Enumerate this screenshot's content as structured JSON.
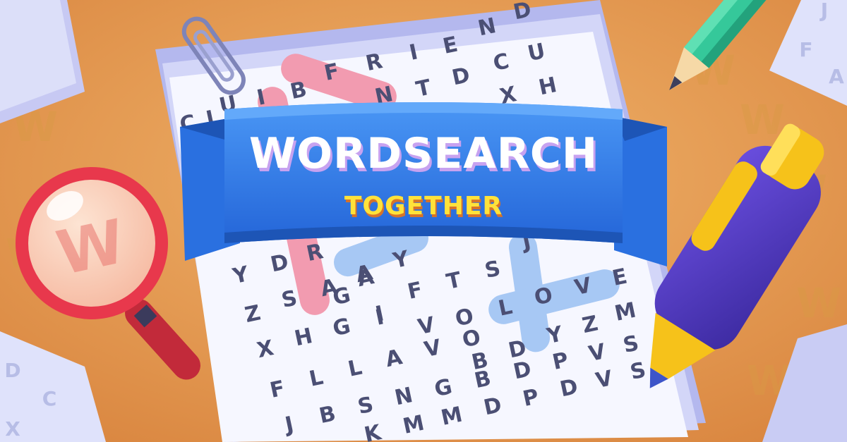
{
  "title": {
    "main": "WORDSEARCH",
    "sub": "TOGETHER"
  },
  "grid_rows": [
    {
      "letters": [
        "D"
      ]
    },
    {
      "letters": [
        "F",
        "R",
        "I",
        "E",
        "N"
      ]
    },
    {
      "letters": [
        "C",
        "U"
      ]
    },
    {
      "letters": [
        "N",
        "T",
        "D"
      ]
    },
    {
      "letters": [
        "U",
        "I",
        "B"
      ]
    },
    {
      "letters": [
        "X",
        "H"
      ]
    },
    {
      "letters": [
        "C",
        "I"
      ]
    },
    {
      "letters": [
        "Y",
        "D",
        "R",
        "A",
        "Y",
        "I",
        "T",
        "J"
      ]
    },
    {
      "letters": [
        "S",
        "A",
        "A",
        "Y",
        "I",
        "F",
        "T",
        "S",
        "J"
      ]
    },
    {
      "letters": [
        "Z",
        "S",
        "X",
        "G",
        "I",
        "F",
        "T",
        "S",
        "L",
        "O",
        "V",
        "E"
      ]
    },
    {
      "letters": [
        "X",
        "H",
        "G",
        "I",
        "V",
        "O",
        "L",
        "O",
        "V",
        "Y",
        "Z",
        "M"
      ]
    },
    {
      "letters": [
        "X",
        "H",
        "G",
        "L",
        "A",
        "V",
        "O",
        "B",
        "D",
        "Y",
        "Z",
        "M"
      ]
    },
    {
      "letters": [
        "F",
        "L",
        "L",
        "A",
        "V",
        "O",
        "B",
        "D",
        "Y",
        "Z",
        "V",
        "S"
      ]
    },
    {
      "letters": [
        "J",
        "B",
        "S",
        "N",
        "G",
        "B",
        "D",
        "P",
        "D",
        "V",
        "S"
      ]
    },
    {
      "letters": [
        "J",
        "B",
        "K",
        "M",
        "M",
        "D",
        "P",
        "D",
        "V",
        "S"
      ]
    }
  ],
  "side_letters": {
    "right_note": [
      "J",
      "F",
      "A"
    ],
    "left_note": [
      "D",
      "C",
      "X"
    ]
  },
  "magnifier": {
    "lens_letter": "W"
  },
  "watermark_letter": "W",
  "colors": {
    "background": "#e29a52",
    "paper": "#f6f7ff",
    "ribbon": "#2f7fe8",
    "ribbon_dark": "#1f5fcc",
    "title_white": "#ffffff",
    "title_yellow": "#ffe23a",
    "highlight_pink": "#f29bb0",
    "highlight_blue": "#a7c8f4",
    "pen_body": "#5a3fc4",
    "pen_yellow": "#f6c21a",
    "pencil_green": "#35c89a",
    "magnifier_red": "#e8384c"
  }
}
